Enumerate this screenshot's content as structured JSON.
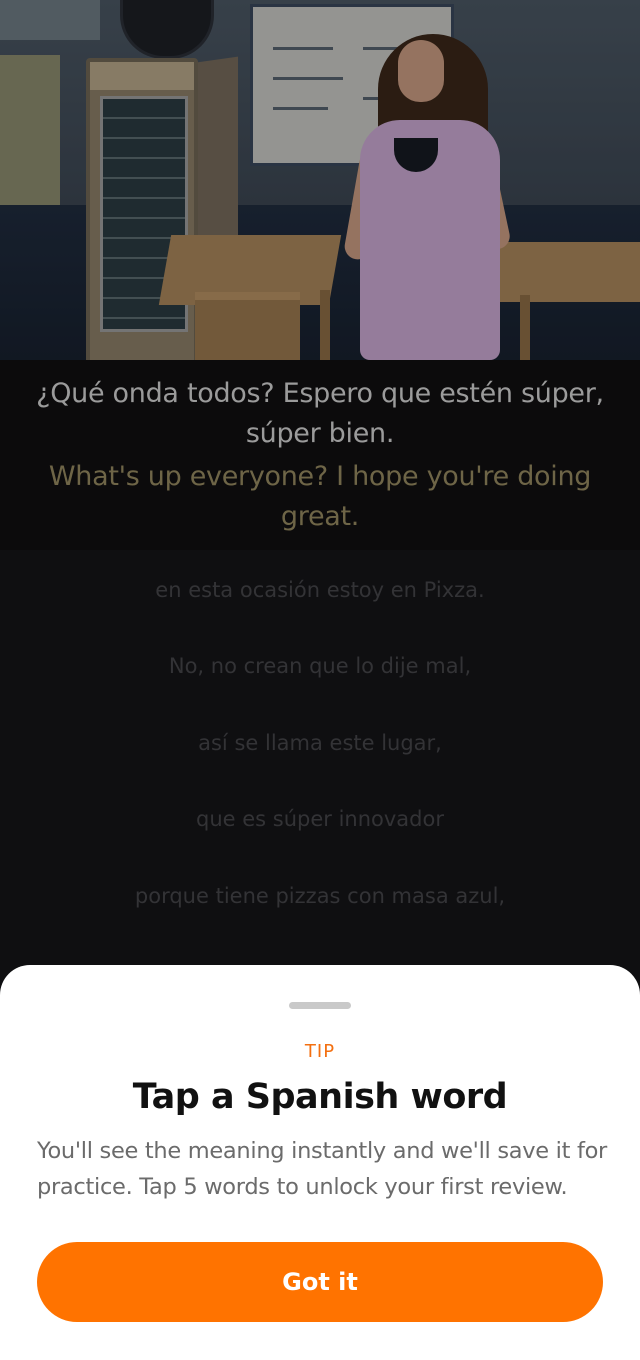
{
  "caption": {
    "spanish": "¿Qué onda todos? Espero que estén súper, súper bien.",
    "english": "What's up everyone? I hope you're doing great."
  },
  "transcript": [
    "en esta ocasión estoy en Pixza.",
    "No, no crean que lo dije mal,",
    "así se llama este lugar,",
    "que es súper innovador",
    "porque tiene pizzas con masa azul,"
  ],
  "tip_sheet": {
    "label": "TIP",
    "title": "Tap a Spanish word",
    "description": "You'll see the meaning instantly and we'll save it for practice. Tap 5 words to unlock your first review.",
    "button_label": "Got it"
  },
  "colors": {
    "accent": "#ff7300",
    "tip_label": "#f36f10",
    "caption_english": "#6e6547"
  }
}
